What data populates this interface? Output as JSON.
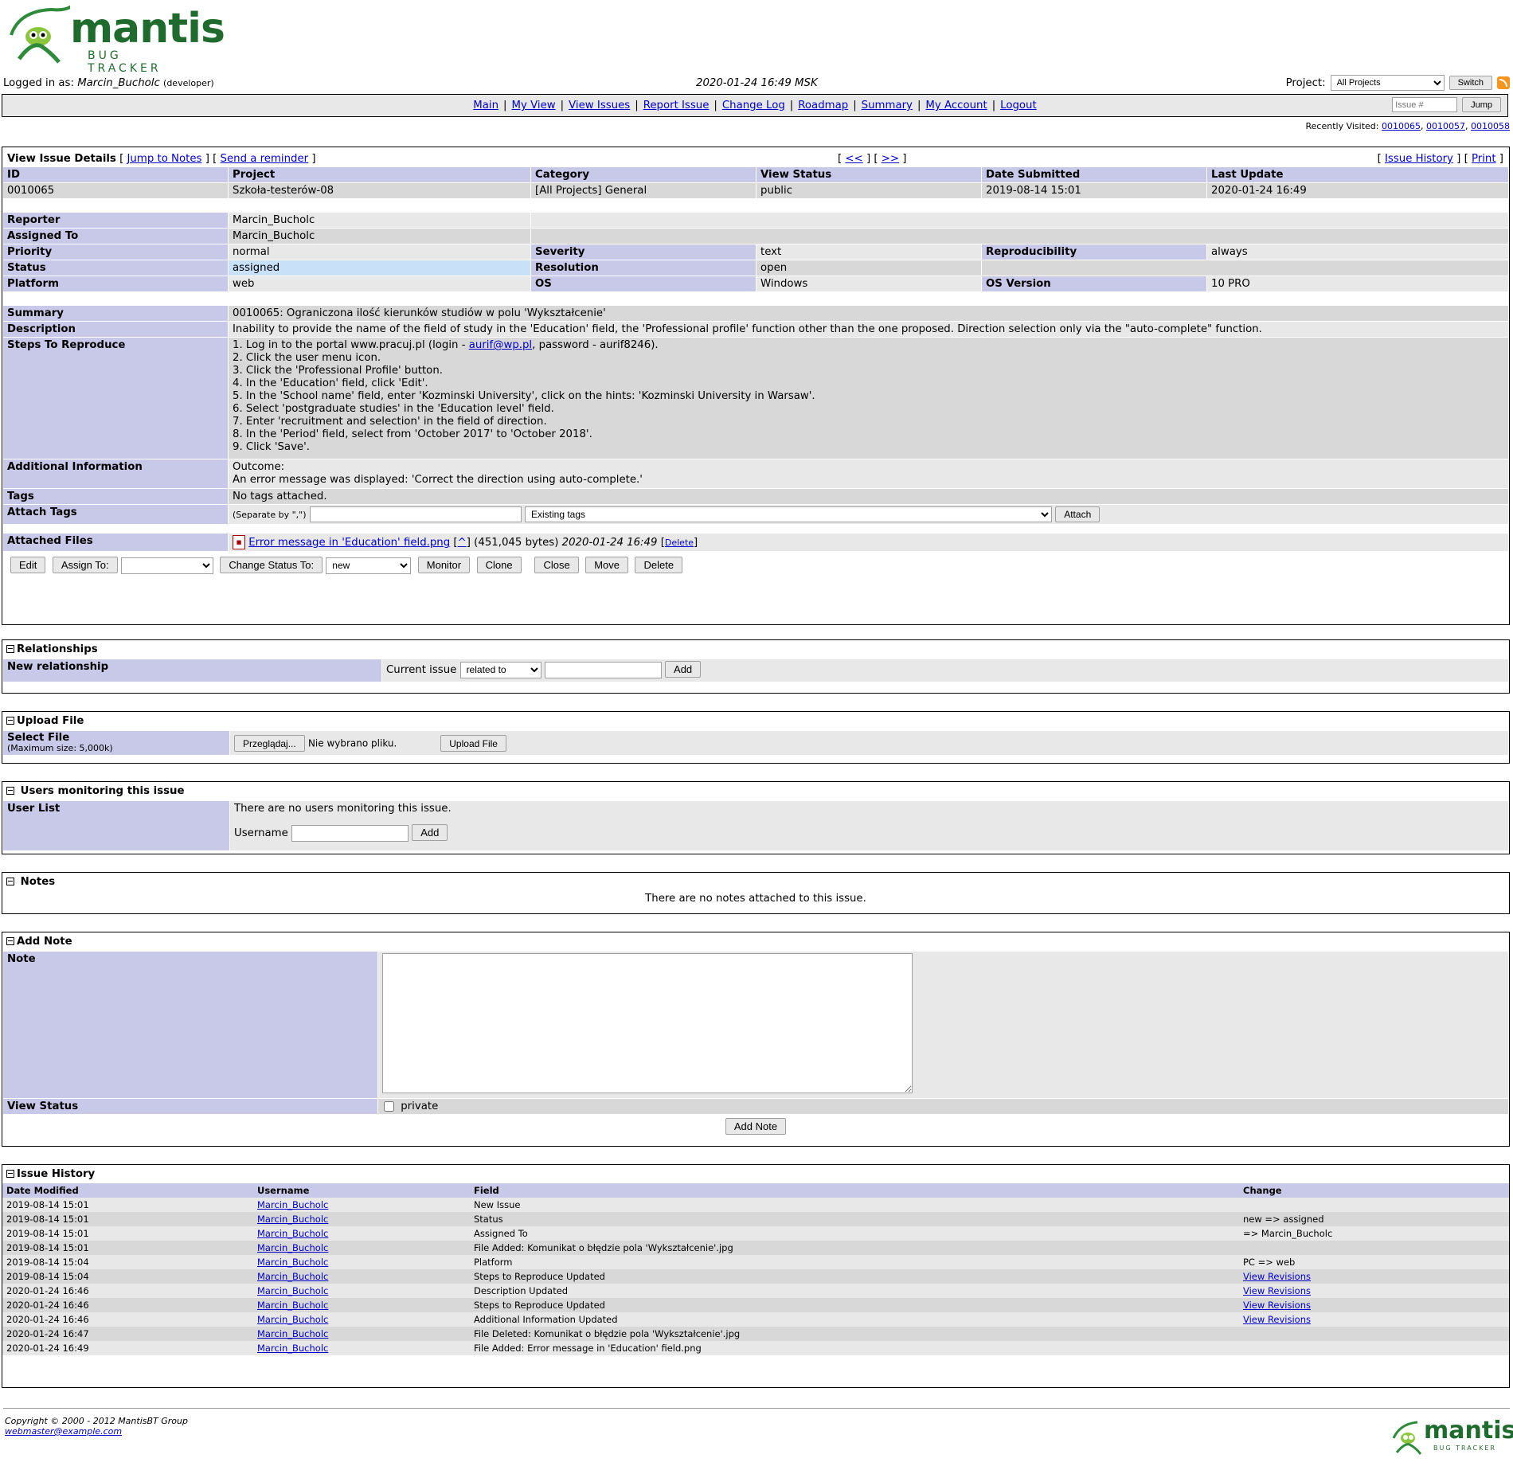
{
  "app": {
    "logo_word": "mantis",
    "logo_sub": "BUG TRACKER",
    "logged_in_prefix": "Logged in as:",
    "username": "Marcin_Bucholc",
    "role": "(developer)",
    "datetime": "2020-01-24 16:49 MSK",
    "project_label": "Project:",
    "project_selected": "All Projects",
    "switch_label": "Switch"
  },
  "menu": {
    "links": [
      "Main",
      "My View",
      "View Issues",
      "Report Issue",
      "Change Log",
      "Roadmap",
      "Summary",
      "My Account",
      "Logout"
    ],
    "jump_placeholder": "Issue #",
    "jump_label": "Jump"
  },
  "recent": {
    "label": "Recently Visited:",
    "items": [
      "0010065",
      "0010057",
      "0010058"
    ]
  },
  "issue": {
    "title": "View Issue Details",
    "jump_to_notes": "Jump to Notes",
    "send_reminder": "Send a reminder",
    "prev": "<<",
    "next": ">>",
    "history_link": "Issue History",
    "print_link": "Print",
    "headers": [
      "ID",
      "Project",
      "Category",
      "View Status",
      "Date Submitted",
      "Last Update"
    ],
    "values": [
      "0010065",
      "Szkoła-testerów-08",
      "[All Projects] General",
      "public",
      "2019-08-14 15:01",
      "2020-01-24 16:49"
    ],
    "reporter_label": "Reporter",
    "reporter": "Marcin_Bucholc",
    "assigned_label": "Assigned To",
    "assigned": "Marcin_Bucholc",
    "priority_label": "Priority",
    "priority": "normal",
    "severity_label": "Severity",
    "severity": "text",
    "repro_label": "Reproducibility",
    "repro": "always",
    "status_label": "Status",
    "status": "assigned",
    "resolution_label": "Resolution",
    "resolution": "open",
    "platform_label": "Platform",
    "platform": "web",
    "os_label": "OS",
    "os": "Windows",
    "osver_label": "OS Version",
    "osver": "10 PRO",
    "summary_label": "Summary",
    "summary": "0010065: Ograniczona ilość kierunków studiów w polu 'Wykształcenie'",
    "description_label": "Description",
    "description": "Inability to provide the name of the field of study in the 'Education' field, the 'Professional profile' function other than the one proposed. Direction selection only via the \"auto-complete\" function.",
    "steps_label": "Steps To Reproduce",
    "step1_pre": "1. Log in to the portal www.pracuj.pl (login - ",
    "step1_link": "aurif@wp.pl",
    "step1_post": ", password - aurif8246).",
    "steps": [
      "2. Click the user menu icon.",
      "3. Click the 'Professional Profile' button.",
      "4. In the 'Education' field, click 'Edit'.",
      "5. In the 'School name' field, enter 'Kozminski University', click on the hints: 'Kozminski University in Warsaw'.",
      "6. Select 'postgraduate studies' in the 'Education level' field.",
      "7. Enter 'recruitment and selection' in the field of direction.",
      "8. In the 'Period' field, select from 'October 2017' to 'October 2018'.",
      "9. Click 'Save'."
    ],
    "addinfo_label": "Additional Information",
    "addinfo_line1": "Outcome:",
    "addinfo_line2": "An error message was displayed: 'Correct the direction using auto-complete.'",
    "tags_label": "Tags",
    "tags": "No tags attached.",
    "attach_tags_label": "Attach Tags",
    "separate_by": "(Separate by \",\")",
    "existing_tags": "Existing tags",
    "attach_label": "Attach",
    "files_label": "Attached Files",
    "file_name": "Error message in 'Education' field.png",
    "file_caret": "^",
    "file_size": "(451,045 bytes)",
    "file_date": "2020-01-24 16:49",
    "file_delete": "Delete",
    "btn_edit": "Edit",
    "btn_assign": "Assign To:",
    "btn_change_status": "Change Status To:",
    "status_new": "new",
    "btn_monitor": "Monitor",
    "btn_clone": "Clone",
    "btn_close": "Close",
    "btn_move": "Move",
    "btn_delete": "Delete"
  },
  "relationships": {
    "title": "Relationships",
    "new_label": "New relationship",
    "current_issue": "Current issue",
    "relation": "related to",
    "add_label": "Add"
  },
  "upload": {
    "title": "Upload File",
    "select_label": "Select File",
    "max_size": "(Maximum size: 5,000k)",
    "browse": "Przeglądaj...",
    "no_file": "Nie wybrano pliku.",
    "upload_label": "Upload File"
  },
  "monitoring": {
    "title": "Users monitoring this issue",
    "list_label": "User List",
    "none": "There are no users monitoring this issue.",
    "username_label": "Username",
    "add_label": "Add"
  },
  "notes": {
    "title": "Notes",
    "none": "There are no notes attached to this issue."
  },
  "add_note": {
    "title": "Add Note",
    "note_label": "Note",
    "view_status_label": "View Status",
    "private_label": "private",
    "button": "Add Note"
  },
  "history": {
    "title": "Issue History",
    "headers": [
      "Date Modified",
      "Username",
      "Field",
      "Change"
    ],
    "rows": [
      [
        "2019-08-14 15:01",
        "Marcin_Bucholc",
        "New Issue",
        ""
      ],
      [
        "2019-08-14 15:01",
        "Marcin_Bucholc",
        "Status",
        "new => assigned"
      ],
      [
        "2019-08-14 15:01",
        "Marcin_Bucholc",
        "Assigned To",
        "=> Marcin_Bucholc"
      ],
      [
        "2019-08-14 15:01",
        "Marcin_Bucholc",
        "File Added: Komunikat o błędzie pola 'Wykształcenie'.jpg",
        ""
      ],
      [
        "2019-08-14 15:04",
        "Marcin_Bucholc",
        "Platform",
        "PC => web"
      ],
      [
        "2019-08-14 15:04",
        "Marcin_Bucholc",
        "Steps to Reproduce Updated",
        "View Revisions"
      ],
      [
        "2020-01-24 16:46",
        "Marcin_Bucholc",
        "Description Updated",
        "View Revisions"
      ],
      [
        "2020-01-24 16:46",
        "Marcin_Bucholc",
        "Steps to Reproduce Updated",
        "View Revisions"
      ],
      [
        "2020-01-24 16:46",
        "Marcin_Bucholc",
        "Additional Information Updated",
        "View Revisions"
      ],
      [
        "2020-01-24 16:47",
        "Marcin_Bucholc",
        "File Deleted: Komunikat o błędzie pola 'Wykształcenie'.jpg",
        ""
      ],
      [
        "2020-01-24 16:49",
        "Marcin_Bucholc",
        "File Added: Error message in 'Education' field.png",
        ""
      ]
    ]
  },
  "footer": {
    "copyright": "Copyright © 2000 - 2012 MantisBT Group",
    "email": "webmaster@example.com"
  },
  "colors": {
    "category_bg": "#c8c8e8",
    "row1": "#d8d8d8",
    "row2": "#e8e8e8",
    "status_assigned": "#c8e0f8",
    "logo_green": "#1f6b2e"
  }
}
